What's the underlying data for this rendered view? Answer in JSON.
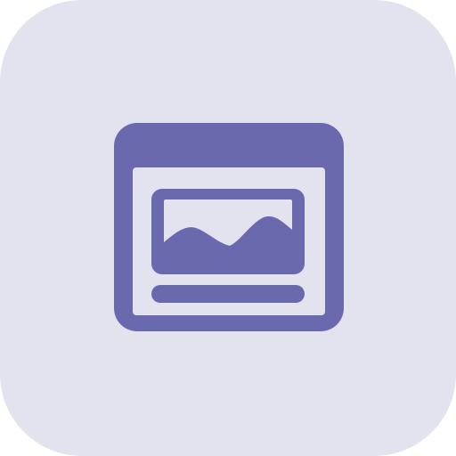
{
  "icon": {
    "name": "browser-window-image-icon",
    "colors": {
      "tile_background": "#e3e2ef",
      "glyph": "#6b69ae",
      "window_inner": "#e3e2ef"
    }
  }
}
